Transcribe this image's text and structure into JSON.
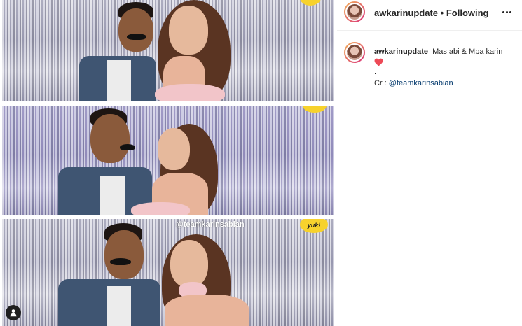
{
  "media": {
    "watermark": "@teamkarinsabian",
    "sticker_text": "yuk!",
    "icons": {
      "user_tag": "user-tag-icon"
    }
  },
  "header": {
    "username": "awkarinupdate",
    "separator": "•",
    "follow_state": "Following",
    "icons": {
      "avatar": "avatar-icon",
      "more": "more-options-icon"
    }
  },
  "caption": {
    "username": "awkarinupdate",
    "text": "Mas abi & Mba karin",
    "dot_line": ".",
    "credit_prefix": "Cr : ",
    "credit_mention": "@teamkarinsabian",
    "icons": {
      "heart": "heart-icon"
    }
  },
  "colors": {
    "text": "#262626",
    "mention": "#00376b",
    "heart": "#ed4956",
    "border": "#efefef",
    "sticker": "#f7d22d"
  }
}
